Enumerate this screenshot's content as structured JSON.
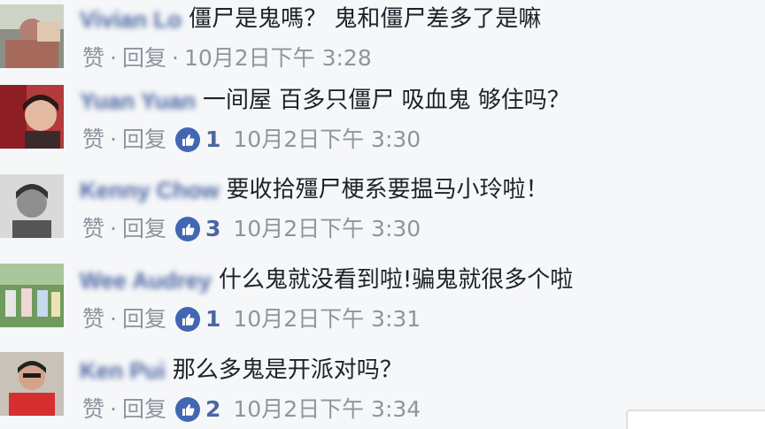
{
  "colors": {
    "background": "#f6f7f9",
    "name_blue": "#4b67a1",
    "text": "#1d2129",
    "meta_gray": "#90949c",
    "like_badge": "#4267b2"
  },
  "comments": [
    {
      "name": "Vivian Lo",
      "text": "僵尸是鬼嗎？ 鬼和僵尸差多了是嘛",
      "like_label": "赞",
      "reply_label": "回复",
      "separator": "·",
      "likes": "",
      "time": "10月2日下午 3:28"
    },
    {
      "name": "Yuan Yuan",
      "text": "一间屋 百多只僵尸 吸血鬼 够住吗？",
      "like_label": "赞",
      "reply_label": "回复",
      "separator": "·",
      "likes": "1",
      "time": "10月2日下午 3:30"
    },
    {
      "name": "Kenny Chow",
      "text": "要收拾殭尸梗系要揾马小玲啦！",
      "like_label": "赞",
      "reply_label": "回复",
      "separator": "·",
      "likes": "3",
      "time": "10月2日下午 3:30"
    },
    {
      "name": "Wee Audrey",
      "text": "什么鬼就没看到啦!骗鬼就很多个啦",
      "like_label": "赞",
      "reply_label": "回复",
      "separator": "·",
      "likes": "1",
      "time": "10月2日下午 3:31"
    },
    {
      "name": "Ken Pui",
      "text": "那么多鬼是开派对吗？",
      "like_label": "赞",
      "reply_label": "回复",
      "separator": "·",
      "likes": "2",
      "time": "10月2日下午 3:34"
    }
  ]
}
